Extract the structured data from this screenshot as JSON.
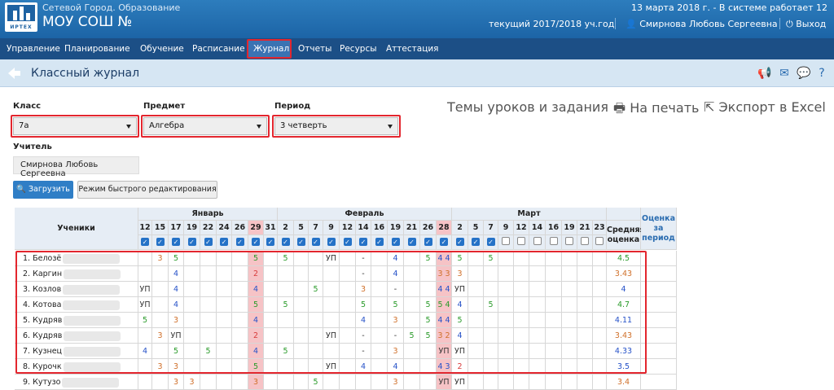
{
  "header": {
    "brand": "Сетевой Город. Образование",
    "school": "МОУ СОШ №",
    "logo_text": "ИРТЕХ",
    "date_line": "13 марта 2018 г. - В системе работает 12",
    "year": "текущий 2017/2018 уч.год",
    "user": "Смирнова Любовь Сергеевна",
    "exit": "Выход"
  },
  "nav": [
    "Управление",
    "Планирование",
    "Обучение",
    "Расписание",
    "Журнал",
    "Отчеты",
    "Ресурсы",
    "Аттестация"
  ],
  "page": {
    "title": "Классный журнал"
  },
  "filters": {
    "class_label": "Класс",
    "class_value": "7а",
    "subject_label": "Предмет",
    "subject_value": "Алгебра",
    "period_label": "Период",
    "period_value": "3 четверть",
    "teacher_label": "Учитель",
    "teacher_value": "Смирнова Любовь Сергеевна"
  },
  "buttons": {
    "load": "Загрузить",
    "fast_edit": "Режим быстрого редактирования"
  },
  "links": {
    "topics": "Темы уроков и задания",
    "print": "На печать",
    "export": "Экспорт в Excel"
  },
  "table": {
    "students_header": "Ученики",
    "avg_header": "Средняя оценка",
    "period_header": "Оценка за период",
    "months": [
      {
        "name": "Январь",
        "days": [
          "12",
          "15",
          "17",
          "19",
          "22",
          "24",
          "26",
          "29",
          "31"
        ]
      },
      {
        "name": "Февраль",
        "days": [
          "2",
          "5",
          "7",
          "9",
          "12",
          "14",
          "16",
          "19",
          "21",
          "26",
          "28"
        ]
      },
      {
        "name": "Март",
        "days": [
          "2",
          "5",
          "7",
          "9",
          "12",
          "14",
          "16",
          "19",
          "21",
          "23"
        ]
      }
    ],
    "rows": [
      {
        "name": "1. Белозё",
        "cells": [
          "",
          "3",
          "5",
          "",
          "",
          "",
          "",
          "5",
          "",
          "5",
          "",
          "",
          "УП",
          "",
          "-",
          "",
          "4",
          "",
          "5",
          "4 4",
          "5",
          "",
          "5",
          "",
          "",
          "",
          "",
          "",
          "",
          ""
        ],
        "avg": "4.5"
      },
      {
        "name": "2. Каргин",
        "cells": [
          "",
          "",
          "4",
          "",
          "",
          "",
          "",
          "2",
          "",
          "",
          "",
          "",
          "",
          "",
          "-",
          "",
          "4",
          "",
          "",
          "3 3",
          "3",
          "",
          "",
          "",
          "",
          "",
          "",
          "",
          "",
          ""
        ],
        "avg": "3.43"
      },
      {
        "name": "3. Козлов",
        "cells": [
          "УП",
          "",
          "4",
          "",
          "",
          "",
          "",
          "4",
          "",
          "",
          "",
          "5",
          "",
          "",
          "3",
          "",
          "-",
          "",
          "",
          "4 4",
          "УП",
          "",
          "",
          "",
          "",
          "",
          "",
          "",
          "",
          ""
        ],
        "avg": "4"
      },
      {
        "name": "4. Котова",
        "cells": [
          "УП",
          "",
          "4",
          "",
          "",
          "",
          "",
          "5",
          "",
          "5",
          "",
          "",
          "",
          "",
          "5",
          "",
          "5",
          "",
          "5",
          "5 4",
          "4",
          "",
          "5",
          "",
          "",
          "",
          "",
          "",
          "",
          ""
        ],
        "avg": "4.7"
      },
      {
        "name": "5. Кудряв",
        "cells": [
          "5",
          "",
          "3",
          "",
          "",
          "",
          "",
          "4",
          "",
          "",
          "",
          "",
          "",
          "",
          "4",
          "",
          "3",
          "",
          "5",
          "4 4",
          "5",
          "",
          "",
          "",
          "",
          "",
          "",
          "",
          "",
          ""
        ],
        "avg": "4.11"
      },
      {
        "name": "6. Кудряв",
        "cells": [
          "",
          "3",
          "УП",
          "",
          "",
          "",
          "",
          "2",
          "",
          "",
          "",
          "",
          "УП",
          "",
          "-",
          "",
          "-",
          "5",
          "5",
          "3 2",
          "4",
          "",
          "",
          "",
          "",
          "",
          "",
          "",
          "",
          ""
        ],
        "avg": "3.43"
      },
      {
        "name": "7. Кузнец",
        "cells": [
          "4",
          "",
          "5",
          "",
          "5",
          "",
          "",
          "4",
          "",
          "5",
          "",
          "",
          "",
          "",
          "-",
          "",
          "3",
          "",
          "",
          "УП",
          "УП",
          "",
          "",
          "",
          "",
          "",
          "",
          "",
          "",
          ""
        ],
        "avg": "4.33"
      },
      {
        "name": "8. Курочк",
        "cells": [
          "",
          "3",
          "3",
          "",
          "",
          "",
          "",
          "5",
          "",
          "",
          "",
          "",
          "УП",
          "",
          "4",
          "",
          "4",
          "",
          "",
          "4 3",
          "2",
          "",
          "",
          "",
          "",
          "",
          "",
          "",
          "",
          ""
        ],
        "avg": "3.5"
      },
      {
        "name": "9. Кутузо",
        "cells": [
          "",
          "",
          "3",
          "3",
          "",
          "",
          "",
          "3",
          "",
          "",
          "",
          "5",
          "",
          "",
          "",
          "",
          "3",
          "",
          "",
          "УП",
          "УП",
          "",
          "",
          "",
          "",
          "",
          "",
          "",
          "",
          ""
        ],
        "avg": "3.4"
      }
    ]
  },
  "colors": {
    "header_blue": "#1c64a6",
    "nav": "#1c4f86",
    "accent_red": "#e3262e",
    "grade5": "#2a9b2a",
    "grade4": "#2652c8",
    "grade3": "#d0702a",
    "grade2": "#d83a3a"
  }
}
